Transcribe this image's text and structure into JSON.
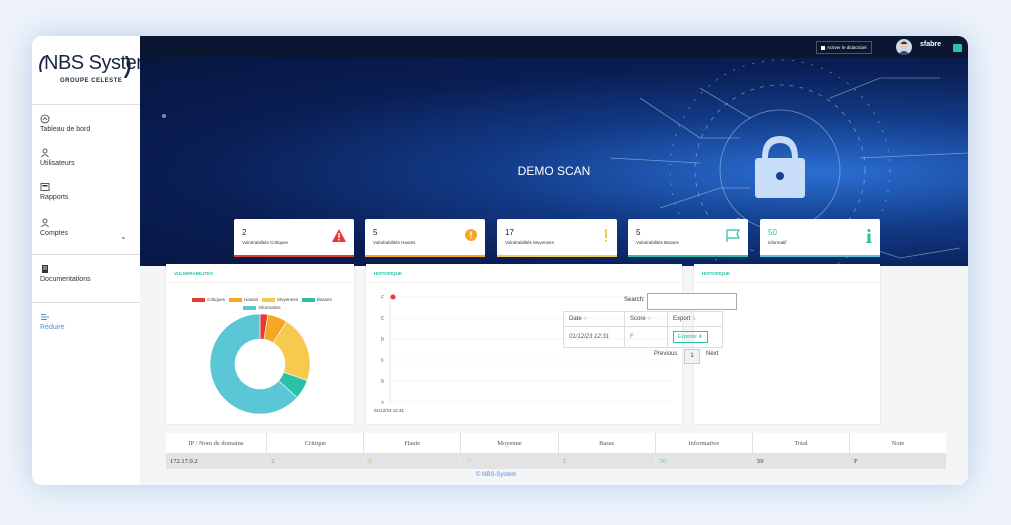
{
  "brand": {
    "name": "NBS System",
    "sub": "GROUPE CELESTE"
  },
  "sidebar": {
    "items": [
      {
        "label": "Tableau de bord",
        "icon": "home-icon"
      },
      {
        "label": "Utilisateurs",
        "icon": "user-icon"
      },
      {
        "label": "Rapports",
        "icon": "report-icon"
      },
      {
        "label": "Comptes",
        "icon": "accounts-icon"
      },
      {
        "label": "Documentations",
        "icon": "doc-icon"
      },
      {
        "label": "Réduire",
        "icon": "menu-icon"
      }
    ]
  },
  "topbar": {
    "activate_label": "Activer le didacticiel",
    "username": "sfabre"
  },
  "hero": {
    "title": "DEMO SCAN"
  },
  "cards": [
    {
      "value": "2",
      "label": "Vulnérabilités Critiques",
      "color": "#e53935"
    },
    {
      "value": "5",
      "label": "Vulnérabilités Hautes",
      "color": "#f5a623"
    },
    {
      "value": "17",
      "label": "Vulnérabilités Moyennes",
      "color": "#f7c94f"
    },
    {
      "value": "5",
      "label": "Vulnérabilités Basses",
      "color": "#2bc0a7"
    },
    {
      "value": "50",
      "label": "informatif",
      "color": "#5bc6d6"
    }
  ],
  "panels": {
    "vuln_title": "VULNÉRABILITÉS",
    "historique_title": "HISTORIQUE",
    "historique2_title": "HISTORIQUE"
  },
  "chart_data": {
    "type": "pie",
    "categories": [
      "Critiques",
      "Hautes",
      "Moyennes",
      "Basses",
      "Informative"
    ],
    "values": [
      2,
      5,
      17,
      5,
      50
    ],
    "colors": [
      "#e53935",
      "#f5a623",
      "#f7c94f",
      "#2bc0a7",
      "#5bc6d6"
    ]
  },
  "history_chart": {
    "y_ticks": [
      "F",
      "E",
      "D",
      "C",
      "B",
      "A"
    ],
    "x_label": "01/12/23 12:31",
    "point_grade": "F"
  },
  "history_table": {
    "search_label": "Search:",
    "columns": [
      "Date",
      "Score",
      "Export"
    ],
    "rows": [
      {
        "date": "01/12/23 12:31",
        "score": "F",
        "export": "Exporter"
      }
    ],
    "previous": "Previous",
    "page": "1",
    "next": "Next"
  },
  "summary": {
    "columns": [
      "IP / Nom de domaine",
      "Critique",
      "Haute",
      "Moyenne",
      "Basse",
      "Informative",
      "Total",
      "Note"
    ],
    "rows": [
      [
        "172.17.0.2",
        "2",
        "5",
        "17",
        "5",
        "50",
        "59",
        "F"
      ]
    ]
  },
  "footer": "© NBS-System"
}
